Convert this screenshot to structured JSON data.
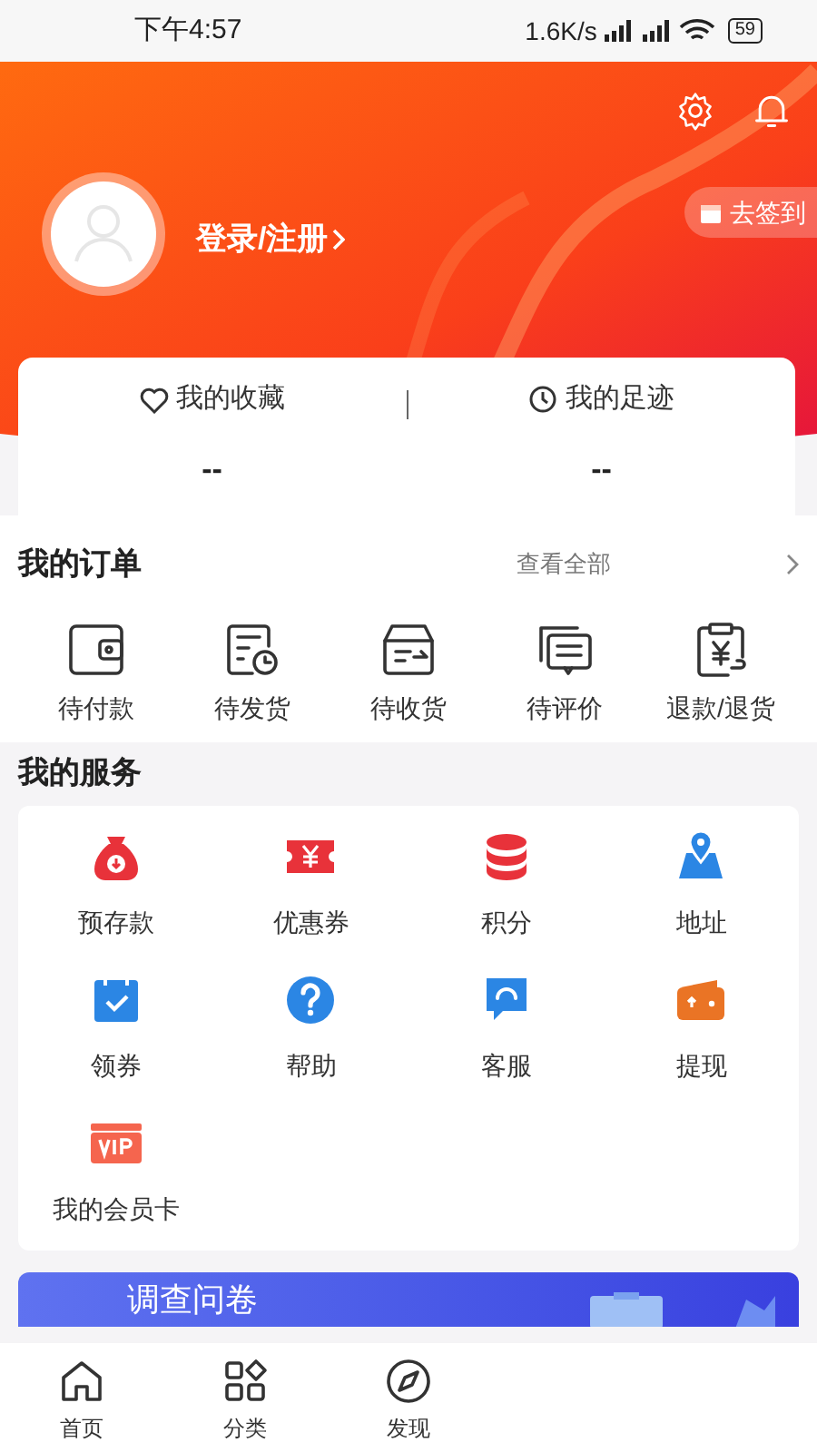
{
  "status_bar": {
    "time": "下午4:57",
    "net_speed": "1.6K/s",
    "battery": "59"
  },
  "profile": {
    "login_link": "登录/注册",
    "check_in_button": "去签到"
  },
  "stats": [
    {
      "label": "我的收藏",
      "value": "--",
      "kind": "heart"
    },
    {
      "label": "我的足迹",
      "value": "--",
      "kind": "clock"
    }
  ],
  "orders": {
    "title": "我的订单",
    "view_all": "查看全部",
    "items": [
      {
        "label": "待付款",
        "kind": "wallet"
      },
      {
        "label": "待发货",
        "kind": "list-clock"
      },
      {
        "label": "待收货",
        "kind": "box"
      },
      {
        "label": "待评价",
        "kind": "chat"
      },
      {
        "label": "退款/退货",
        "kind": "refund"
      }
    ]
  },
  "services": {
    "title": "我的服务",
    "items": [
      {
        "label": "预存款",
        "kind": "bag",
        "color": "#e8323a"
      },
      {
        "label": "优惠券",
        "kind": "ticket",
        "color": "#e8323a"
      },
      {
        "label": "积分",
        "kind": "coins",
        "color": "#e8323a"
      },
      {
        "label": "地址",
        "kind": "map",
        "color": "#2b86e4"
      },
      {
        "label": "领券",
        "kind": "calendar",
        "color": "#2b86e4"
      },
      {
        "label": "帮助",
        "kind": "question",
        "color": "#2b86e4"
      },
      {
        "label": "客服",
        "kind": "bubble",
        "color": "#2b86e4"
      },
      {
        "label": "提现",
        "kind": "purse",
        "color": "#ea7425"
      },
      {
        "label": "我的会员卡",
        "kind": "vip",
        "color": "#f5654e"
      }
    ]
  },
  "banner": {
    "title": "调查问卷"
  },
  "tab_bar": [
    {
      "label": "首页",
      "kind": "home"
    },
    {
      "label": "分类",
      "kind": "grid"
    },
    {
      "label": "发现",
      "kind": "compass"
    }
  ]
}
